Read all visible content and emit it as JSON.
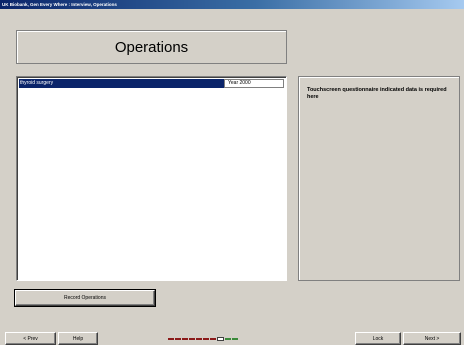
{
  "window": {
    "title": "UK Biobank, Gen Every Where : Interview, Operations"
  },
  "heading": "Operations",
  "operations": [
    {
      "name": "thyroid surgery",
      "year": "Year 2000"
    }
  ],
  "info": {
    "message": "Touchscreen questionnaire indicated data is required here"
  },
  "buttons": {
    "record": "Record Operations",
    "prev": "< Prev",
    "help": "Help",
    "lock": "Lock",
    "next": "Next >"
  },
  "progress": {
    "total_steps": 10,
    "current_step": 8
  },
  "colors": {
    "selection": "#0a246a",
    "progress_done": "#8b1a1a",
    "progress_todo": "#3a8a3a"
  }
}
